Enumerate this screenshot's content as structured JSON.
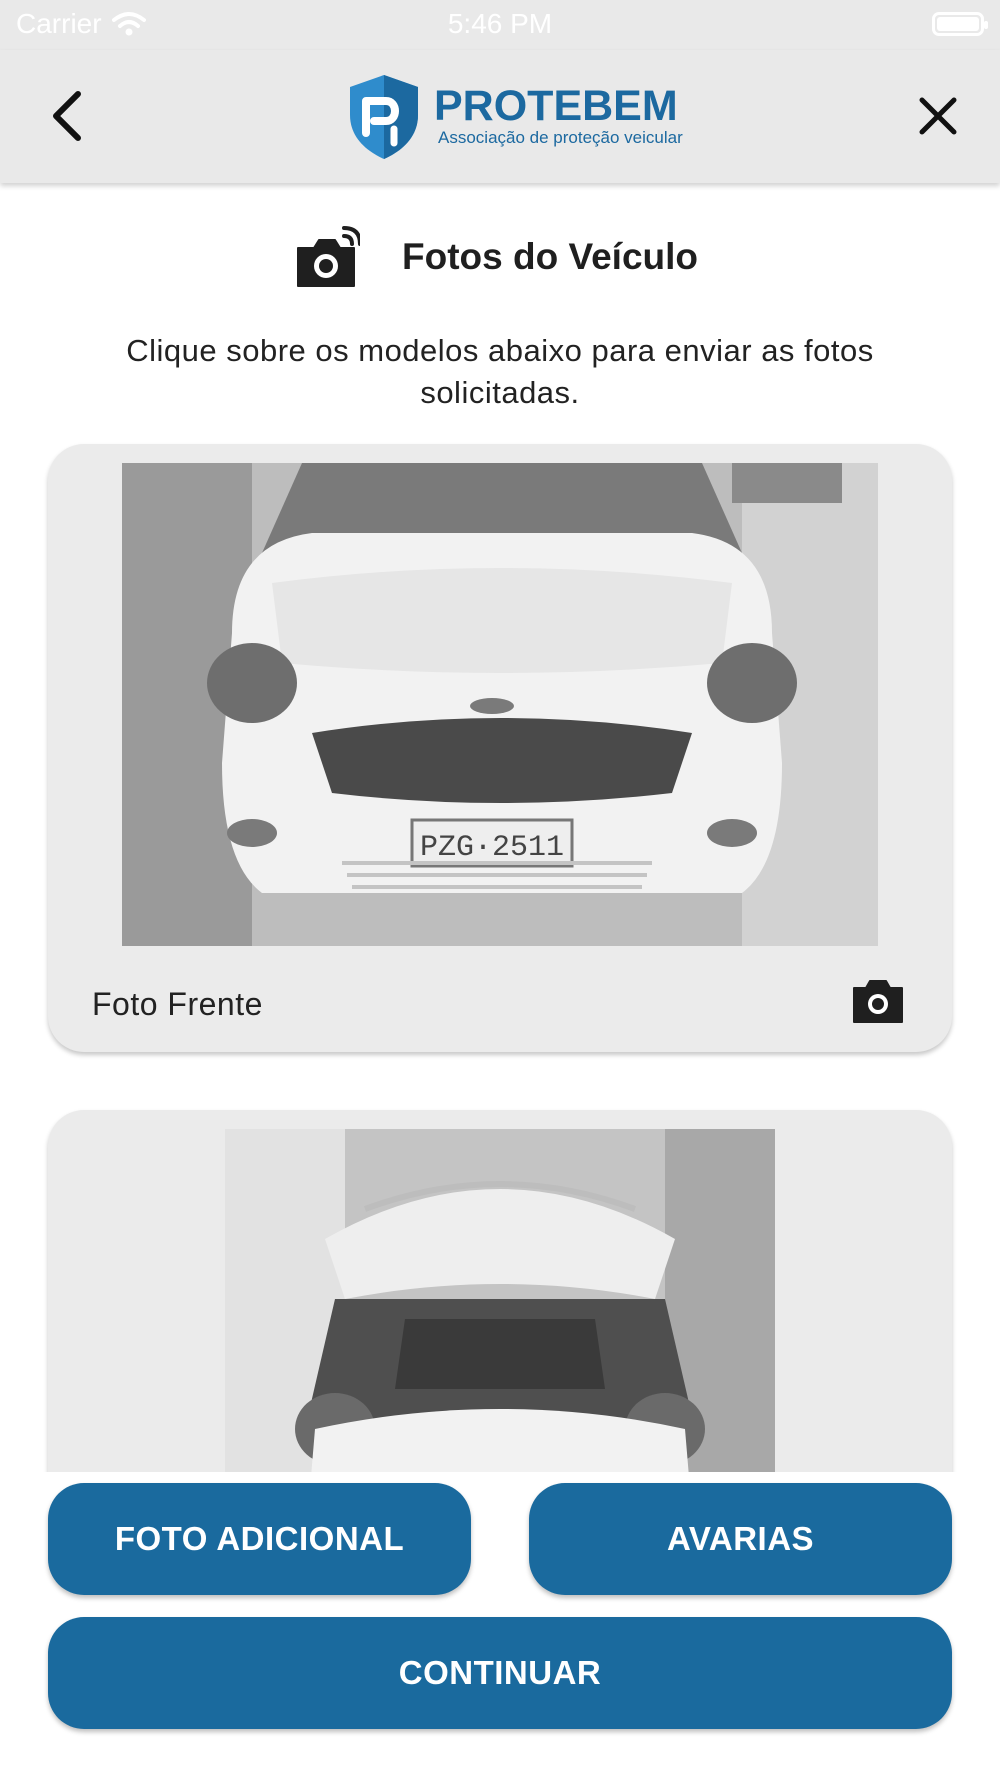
{
  "status_bar": {
    "carrier": "Carrier",
    "time": "5:46 PM"
  },
  "header": {
    "logo_brand": "PROTEBEM",
    "logo_tagline": "Associação de proteção veicular",
    "brand_color": "#1c69a0"
  },
  "section": {
    "title": "Fotos do Veículo",
    "instructions": "Clique sobre os modelos abaixo para enviar as fotos solicitadas."
  },
  "photo_cards": [
    {
      "label": "Foto Frente",
      "plate": "PZG·2511"
    },
    {
      "label": ""
    }
  ],
  "buttons": {
    "extra_photo": "FOTO ADICIONAL",
    "damages": "AVARIAS",
    "continue": "CONTINUAR",
    "color": "#1a6a9e"
  },
  "icons": [
    "chevron-left-icon",
    "close-icon",
    "camera-icon",
    "wifi-icon",
    "battery-icon"
  ]
}
